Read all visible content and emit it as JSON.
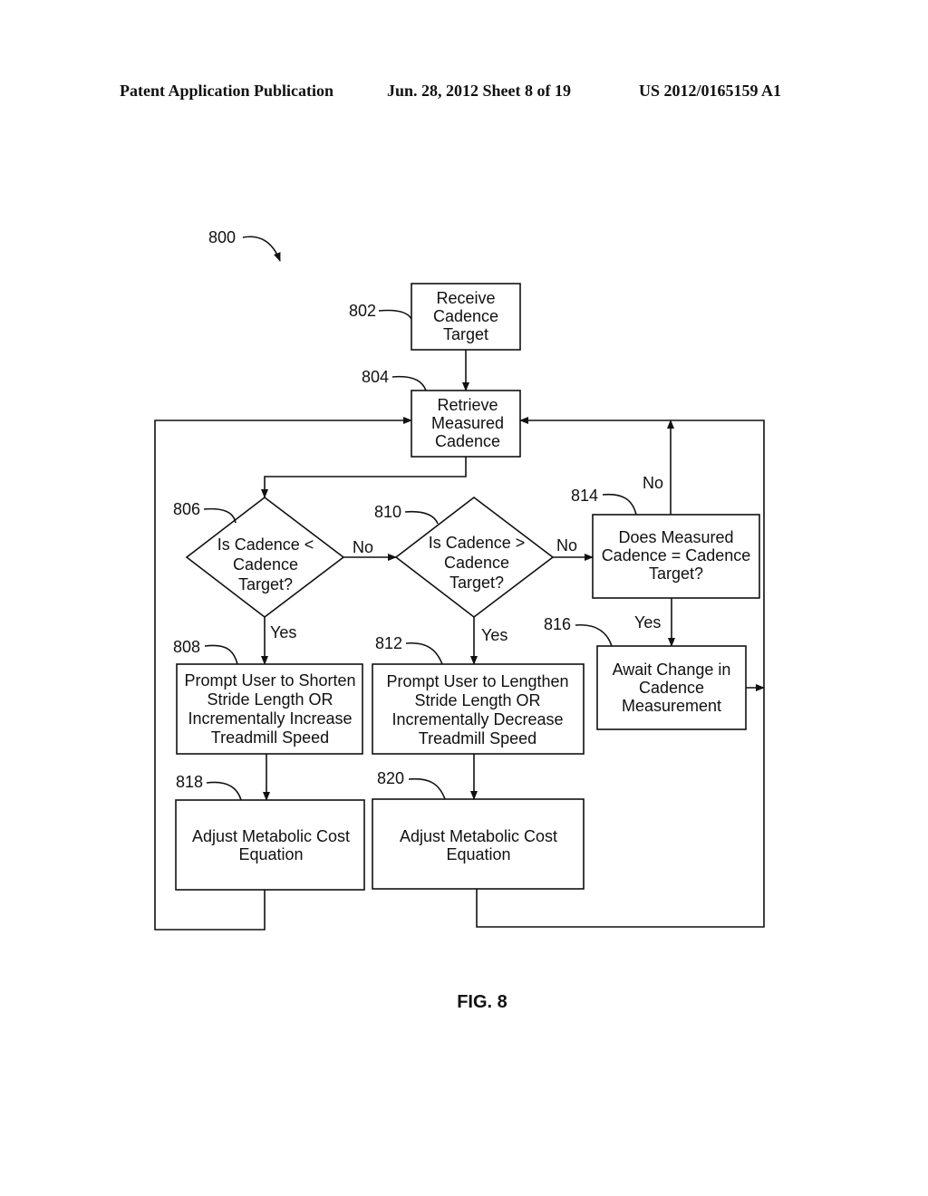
{
  "header": {
    "left": "Patent Application Publication",
    "middle": "Jun. 28, 2012  Sheet 8 of 19",
    "right": "US 2012/0165159 A1"
  },
  "figure": {
    "label": "FIG. 8",
    "ref": "800"
  },
  "nodes": {
    "n802": {
      "ref": "802",
      "lines": [
        "Receive",
        "Cadence",
        "Target"
      ]
    },
    "n804": {
      "ref": "804",
      "lines": [
        "Retrieve",
        "Measured",
        "Cadence"
      ]
    },
    "n806": {
      "ref": "806",
      "lines": [
        "Is Cadence <",
        "Cadence",
        "Target?"
      ]
    },
    "n810": {
      "ref": "810",
      "lines": [
        "Is Cadence >",
        "Cadence",
        "Target?"
      ]
    },
    "n814": {
      "ref": "814",
      "lines": [
        "Does Measured",
        "Cadence = Cadence",
        "Target?"
      ]
    },
    "n808": {
      "ref": "808",
      "lines": [
        "Prompt User to Shorten",
        "Stride Length OR",
        "Incrementally Increase",
        "Treadmill Speed"
      ]
    },
    "n812": {
      "ref": "812",
      "lines": [
        "Prompt User to Lengthen",
        "Stride Length OR",
        "Incrementally Decrease",
        "Treadmill Speed"
      ]
    },
    "n816": {
      "ref": "816",
      "lines": [
        "Await Change in",
        "Cadence",
        "Measurement"
      ]
    },
    "n818": {
      "ref": "818",
      "lines": [
        "Adjust Metabolic Cost",
        "Equation"
      ]
    },
    "n820": {
      "ref": "820",
      "lines": [
        "Adjust Metabolic Cost",
        "Equation"
      ]
    }
  },
  "edge_labels": {
    "no_806_810": "No",
    "yes_806_808": "Yes",
    "no_810_814": "No",
    "yes_810_812": "Yes",
    "no_814_804": "No",
    "yes_814_816": "Yes"
  }
}
